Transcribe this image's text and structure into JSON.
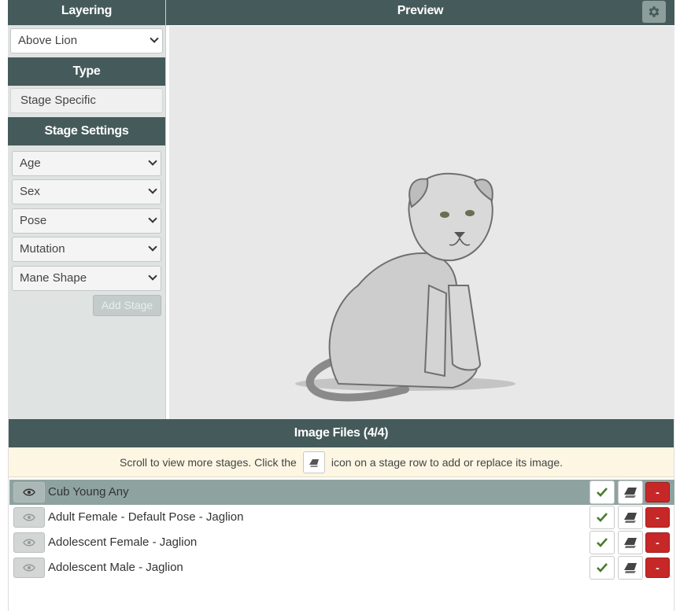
{
  "layering": {
    "header": "Layering",
    "selected": "Above Lion"
  },
  "type": {
    "header": "Type",
    "value": "Stage Specific"
  },
  "stage_settings": {
    "header": "Stage Settings",
    "selects": [
      "Age",
      "Sex",
      "Pose",
      "Mutation",
      "Mane Shape"
    ],
    "add_button": "Add Stage"
  },
  "preview": {
    "header": "Preview",
    "settings_icon": "gear-icon"
  },
  "image_files": {
    "header": "Image Files (4/4)",
    "notice_before": "Scroll to view more stages. Click the",
    "notice_after": "icon on a stage row to add or replace its image.",
    "rows": [
      {
        "label": "Cub Young Any",
        "active": true
      },
      {
        "label": "Adult Female - Default Pose - Jaglion",
        "active": false
      },
      {
        "label": "Adolescent Female - Jaglion",
        "active": false
      },
      {
        "label": "Adolescent Male - Jaglion",
        "active": false
      }
    ],
    "delete_label": "-"
  },
  "colors": {
    "header": "#455a5a",
    "panel": "#dfe3e2",
    "delete": "#c62828",
    "active_row": "#8ea3a0",
    "check": "#4a7a2f"
  }
}
